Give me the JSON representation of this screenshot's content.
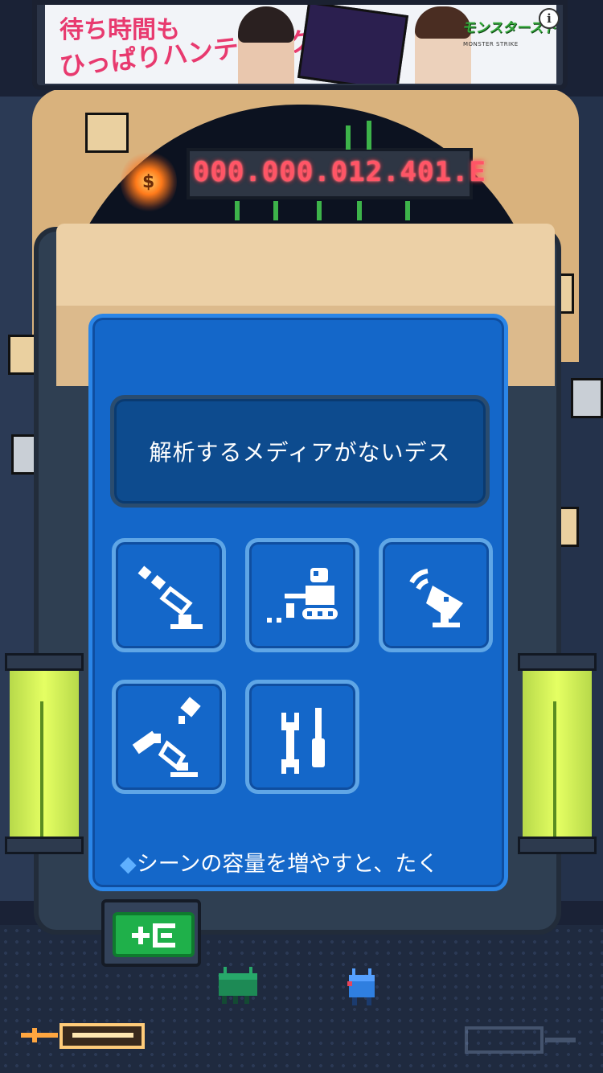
{
  "ad": {
    "headline_1": "待ち時間も",
    "headline_2": "ひっぱりハンティング",
    "logo_text": "モンスターストライク",
    "logo_sub": "MONSTER STRIKE",
    "info_label": "i"
  },
  "counter": {
    "value": "000.000.012.401.E",
    "currency_symbol": "$"
  },
  "lab": {
    "message": "解析するメディアがないデス",
    "tools": [
      {
        "name": "telescope",
        "icon": "telescope-icon"
      },
      {
        "name": "rover",
        "icon": "rover-icon"
      },
      {
        "name": "antenna",
        "icon": "satellite-dish-icon"
      },
      {
        "name": "satellite",
        "icon": "satellite-icon"
      },
      {
        "name": "tools",
        "icon": "wrench-screwdriver-icon"
      }
    ],
    "tip": "シーンの容量を増やすと、たく"
  },
  "exit": {
    "icon": "exit-arrow-icon"
  },
  "colors": {
    "panel": "#1467c9",
    "panel_border": "#5fa6e6",
    "message_bg": "#0d4b8e",
    "counter": "#ff5566",
    "exit_button": "#1fb04a",
    "tube_liquid": "#e5ff63"
  }
}
